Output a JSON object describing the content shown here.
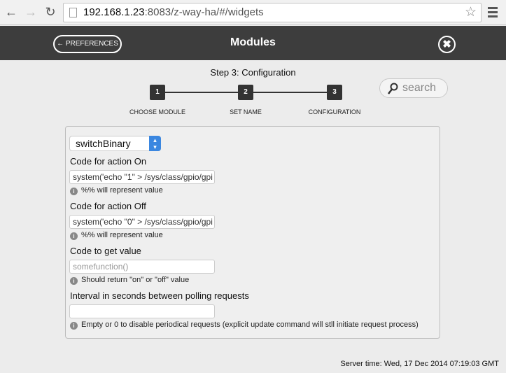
{
  "browser": {
    "url_host": "192.168.1.23",
    "url_path": ":8083/z-way-ha/#/widgets",
    "icons": [
      "back-arrow",
      "forward-arrow",
      "reload",
      "page",
      "star",
      "menu"
    ]
  },
  "header": {
    "back_label": "← PREFERENCES",
    "title": "Modules",
    "close_icon": "✖"
  },
  "wizard": {
    "title": "Step 3: Configuration",
    "steps": [
      {
        "num": "1",
        "label": "CHOOSE MODULE"
      },
      {
        "num": "2",
        "label": "SET NAME"
      },
      {
        "num": "3",
        "label": "CONFIGURATION"
      }
    ]
  },
  "search": {
    "placeholder": "search"
  },
  "form": {
    "module_select": "switchBinary",
    "fields": [
      {
        "label": "Code for action On",
        "value": "system('echo \"1\" > /sys/class/gpio/gpi",
        "placeholder": "",
        "help": "%% will represent value"
      },
      {
        "label": "Code for action Off",
        "value": "system('echo \"0\" > /sys/class/gpio/gpi",
        "placeholder": "",
        "help": "%% will represent value"
      },
      {
        "label": "Code to get value",
        "value": "",
        "placeholder": "somefunction()",
        "help": "Should return \"on\" or \"off\" value"
      },
      {
        "label": "Interval in seconds between polling requests",
        "value": "",
        "placeholder": "",
        "help": "Empty or 0 to disable periodical requests (explicit update command will stll initiate request process)"
      }
    ]
  },
  "footer": {
    "server_time": "Server time: Wed, 17 Dec 2014 07:19:03 GMT"
  },
  "colors": {
    "header": "#3d3d3d",
    "select_accent": "#3b87e0"
  }
}
